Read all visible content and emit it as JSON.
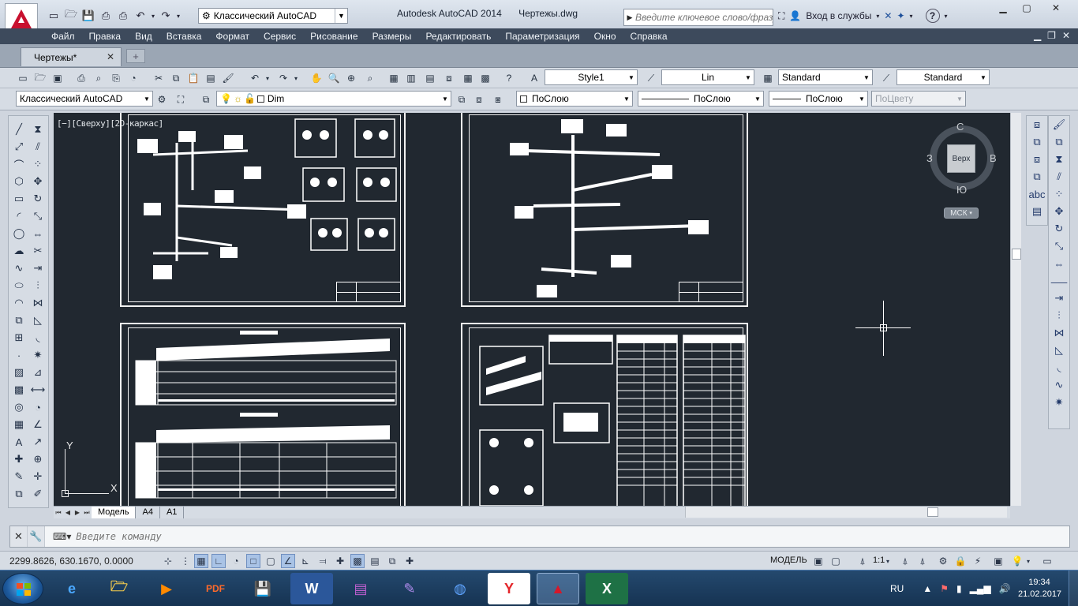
{
  "titlebar": {
    "workspace": "Классический AutoCAD",
    "app_name": "Autodesk AutoCAD 2014",
    "file_name": "Чертежы.dwg",
    "search_placeholder": "Введите ключевое слово/фразу",
    "signin": "Вход в службы"
  },
  "menu": [
    "Файл",
    "Правка",
    "Вид",
    "Вставка",
    "Формат",
    "Сервис",
    "Рисование",
    "Размеры",
    "Редактировать",
    "Параметризация",
    "Окно",
    "Справка"
  ],
  "doc_tab": {
    "label": "Чертежы*"
  },
  "toolbar1": {
    "text_style": "Style1",
    "dim_style": "Lin",
    "table_style": "Standard",
    "mleader_style": "Standard"
  },
  "toolbar2": {
    "workspace": "Классический AutoCAD",
    "layer": "Dim",
    "color": "ПоСлою",
    "linetype": "ПоСлою",
    "lineweight": "ПоСлою",
    "plotstyle": "ПоЦвету"
  },
  "viewport": {
    "label": "[−][Сверху][2D-каркас]",
    "viewcube": {
      "face": "Верх",
      "north": "С",
      "south": "Ю",
      "east": "В",
      "west": "З",
      "ucs": "МСК"
    },
    "ucs_x": "X",
    "ucs_y": "Y"
  },
  "layout_tabs": [
    "Модель",
    "A4",
    "A1"
  ],
  "command": {
    "placeholder": "Введите команду"
  },
  "status": {
    "coords": "2299.8626, 630.1670, 0.0000",
    "model": "МОДЕЛЬ",
    "scale": "1:1"
  },
  "taskbar": {
    "lang": "RU",
    "time": "19:34",
    "date": "21.02.2017"
  },
  "colors": {
    "canvas": "#212830",
    "menubar": "#3d4a5c",
    "taskbar": "#1a3a5c",
    "autocad_red": "#c8102e"
  }
}
